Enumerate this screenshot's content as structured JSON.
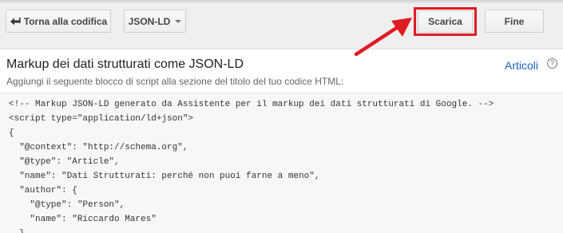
{
  "toolbar": {
    "back_label": "Torna alla codifica",
    "back_icon": "back-arrow-icon",
    "format_label": "JSON-LD",
    "format_icon": "caret-down-icon",
    "download_label": "Scarica",
    "done_label": "Fine"
  },
  "header": {
    "title": "Markup dei dati strutturati come JSON-LD",
    "subtitle": "Aggiungi il seguente blocco di script alla sezione del titolo del tuo codice HTML:",
    "doc_type_link": "Articoli",
    "help_icon_text": "?"
  },
  "code": {
    "lines": [
      "<!-- Markup JSON-LD generato da Assistente per il markup dei dati strutturati di Google. -->",
      "<script type=\"application/ld+json\">",
      "{",
      "  \"@context\": \"http://schema.org\",",
      "  \"@type\": \"Article\",",
      "  \"name\": \"Dati Strutturati: perché non puoi farne a meno\",",
      "  \"author\": {",
      "    \"@type\": \"Person\",",
      "    \"name\": \"Riccardo Mares\"",
      "  }"
    ]
  },
  "colors": {
    "highlight": "#e01b24",
    "link": "#1a5fc9",
    "toolbar_bg": "#efefef"
  }
}
